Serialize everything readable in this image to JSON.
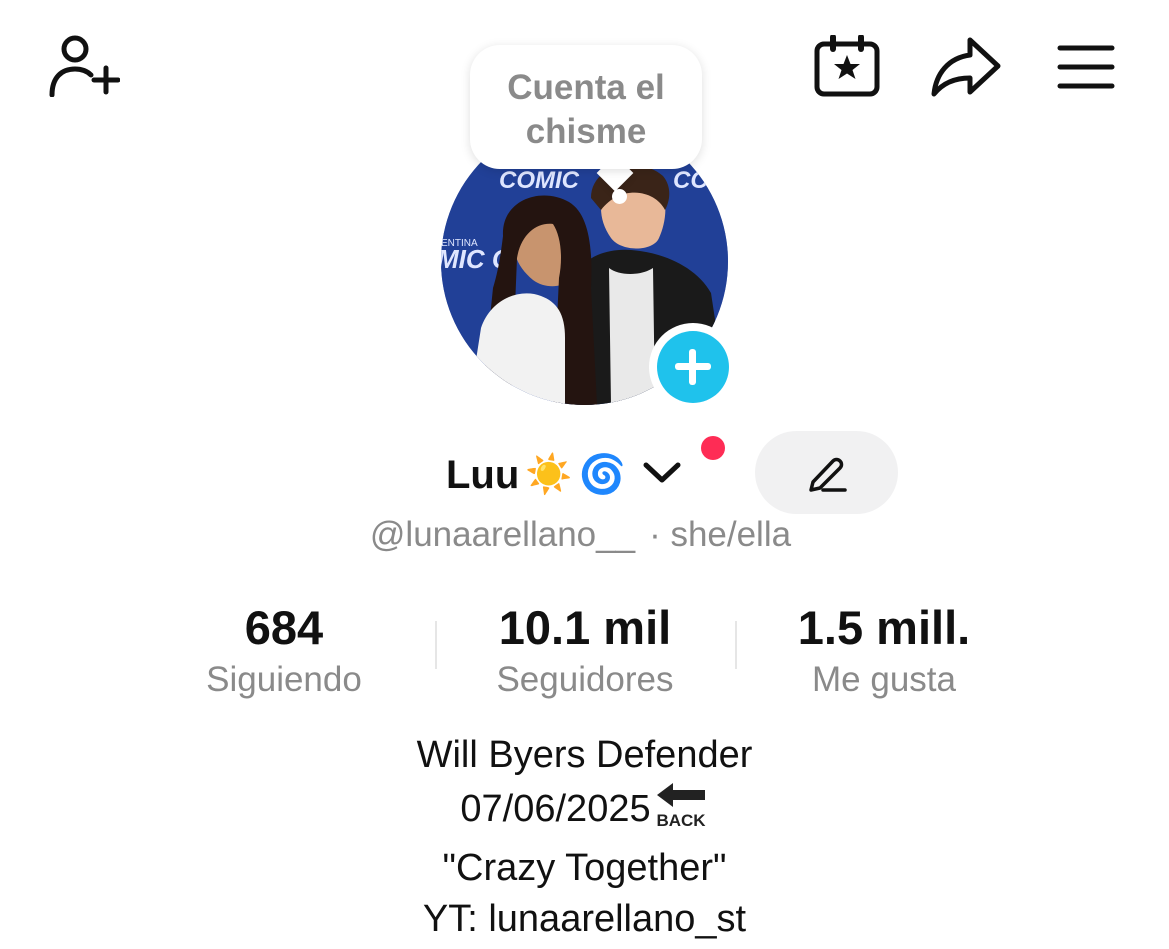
{
  "header": {
    "icons": [
      "add-friend-icon",
      "calendar-star-icon",
      "share-icon",
      "menu-icon"
    ]
  },
  "bubble": {
    "text_line1": "Cuenta el",
    "text_line2": "chisme"
  },
  "avatar": {
    "photo_text_left": "COMIC",
    "photo_text_right": "COM",
    "photo_text_mid": "MIC C",
    "photo_text_small": "ENTINA"
  },
  "profile": {
    "name": "Luu",
    "emojis": [
      "☀️",
      "🌀"
    ],
    "handle": "@lunaarellano__",
    "pronouns": "· she/ella"
  },
  "stats": [
    {
      "value": "684",
      "label": "Siguiendo"
    },
    {
      "value": "10.1 mil",
      "label": "Seguidores"
    },
    {
      "value": "1.5 mill.",
      "label": "Me gusta"
    }
  ],
  "bio": {
    "line1": "Will Byers Defender",
    "line2": "07/06/2025",
    "back_label": "BACK",
    "line3": "\"Crazy Together\"",
    "line4": "YT: lunaarellano_st"
  },
  "colors": {
    "accent_cyan": "#1fc2ec",
    "notification_red": "#fe2c55",
    "muted_gray": "#8a8a8a"
  }
}
